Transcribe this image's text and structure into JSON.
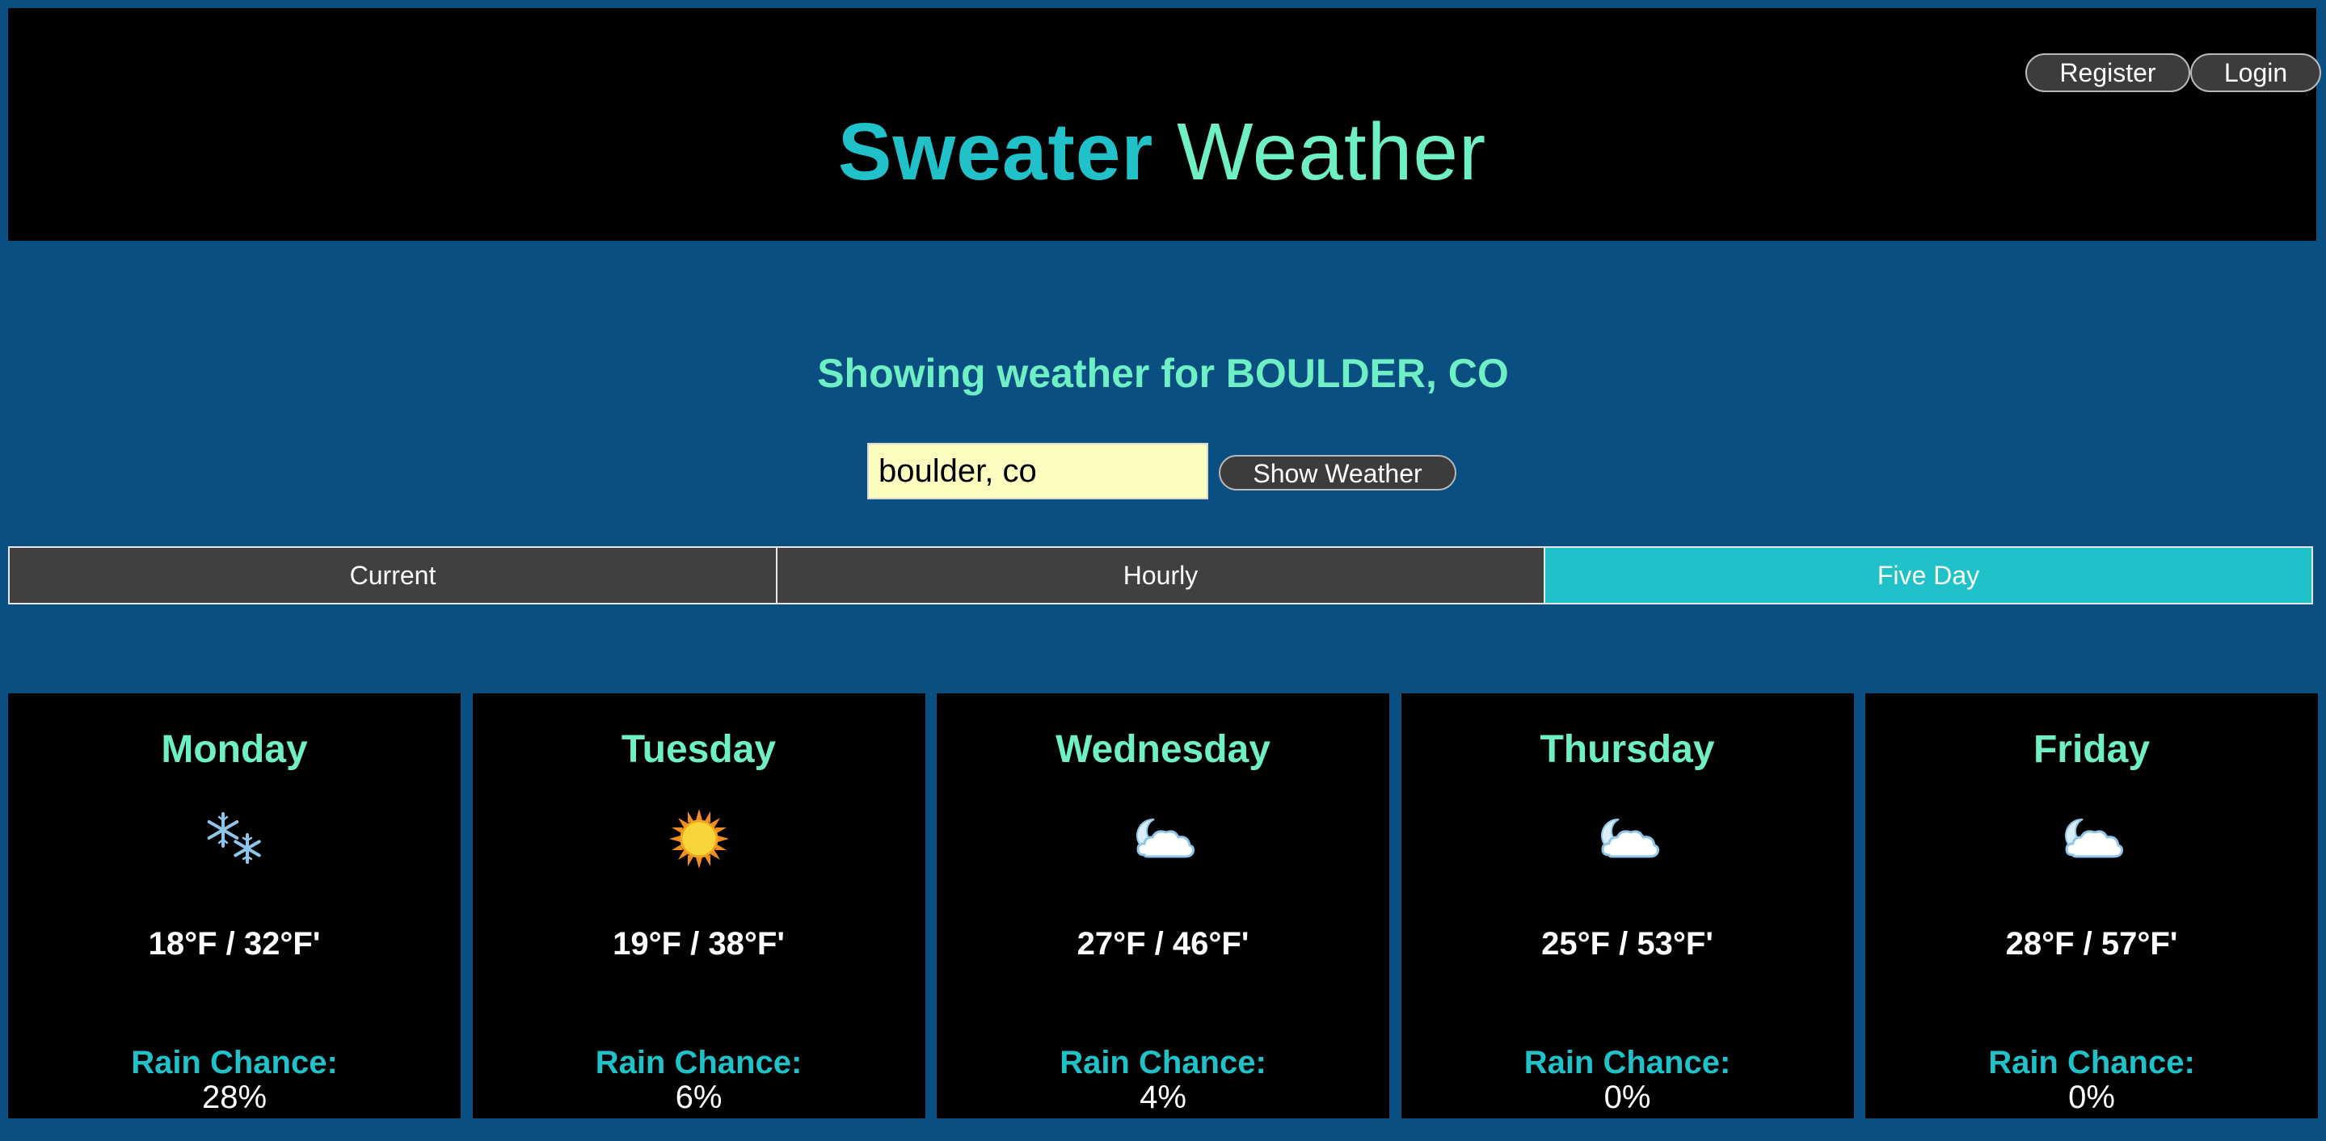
{
  "header": {
    "title_bold": "Sweater",
    "title_light": "Weather",
    "register_label": "Register",
    "login_label": "Login"
  },
  "search": {
    "heading": "Showing weather for BOULDER, CO",
    "input_value": "boulder, co",
    "button_label": "Show Weather"
  },
  "tabs": [
    {
      "label": "Current",
      "active": false
    },
    {
      "label": "Hourly",
      "active": false
    },
    {
      "label": "Five Day",
      "active": true
    }
  ],
  "forecast": {
    "rain_label": "Rain Chance:",
    "days": [
      {
        "day": "Monday",
        "icon": "snow-icon",
        "temp": "18°F / 32°F'",
        "rain": "28%"
      },
      {
        "day": "Tuesday",
        "icon": "sun-icon",
        "temp": "19°F / 38°F'",
        "rain": "6%"
      },
      {
        "day": "Wednesday",
        "icon": "partly-cloudy-night-icon",
        "temp": "27°F / 46°F'",
        "rain": "4%"
      },
      {
        "day": "Thursday",
        "icon": "partly-cloudy-night-icon",
        "temp": "25°F / 53°F'",
        "rain": "0%"
      },
      {
        "day": "Friday",
        "icon": "partly-cloudy-night-icon",
        "temp": "28°F / 57°F'",
        "rain": "0%"
      }
    ]
  },
  "colors": {
    "background": "#0a4f81",
    "accent_teal": "#21c1c9",
    "accent_mint": "#6fefc4",
    "input_bg": "#fdfdbf",
    "button_bg": "#3c3c3c"
  }
}
